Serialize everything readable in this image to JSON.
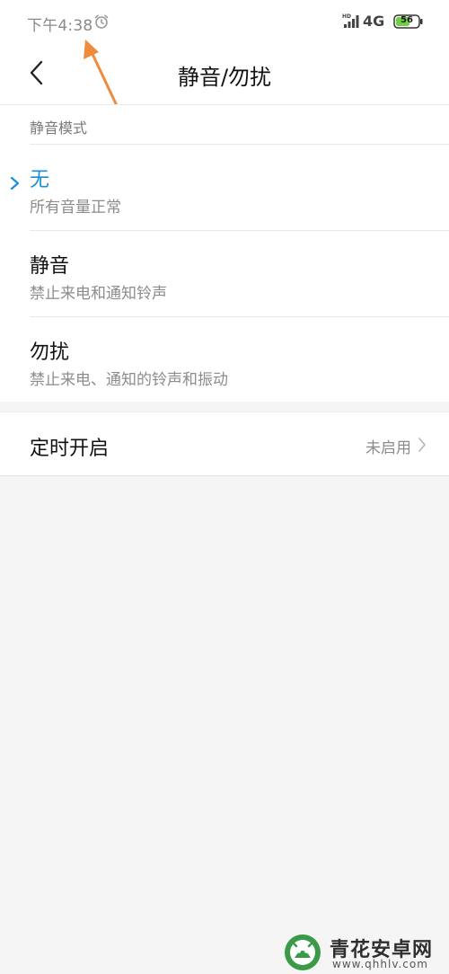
{
  "status_bar": {
    "time": "下午4:38",
    "network": "4G",
    "battery": "56"
  },
  "header": {
    "title": "静音/勿扰"
  },
  "mode_section": {
    "header": "静音模式",
    "items": [
      {
        "title": "无",
        "subtitle": "所有音量正常",
        "selected": true
      },
      {
        "title": "静音",
        "subtitle": "禁止来电和通知铃声",
        "selected": false
      },
      {
        "title": "勿扰",
        "subtitle": "禁止来电、通知的铃声和振动",
        "selected": false
      }
    ]
  },
  "timer": {
    "label": "定时开启",
    "value": "未启用"
  },
  "watermark": {
    "title": "青花安卓网",
    "url": "www.qhhlv.com"
  },
  "colors": {
    "accent": "#1b8fd6",
    "annotation_arrow": "#f08a3c",
    "battery_green": "#6fd13e"
  },
  "icons": {
    "alarm": "alarm-clock-icon",
    "signal": "signal-strength-icon",
    "battery": "battery-icon",
    "back": "back-chevron-icon",
    "check": "selected-chevron-icon",
    "chevron": "chevron-right-icon"
  }
}
